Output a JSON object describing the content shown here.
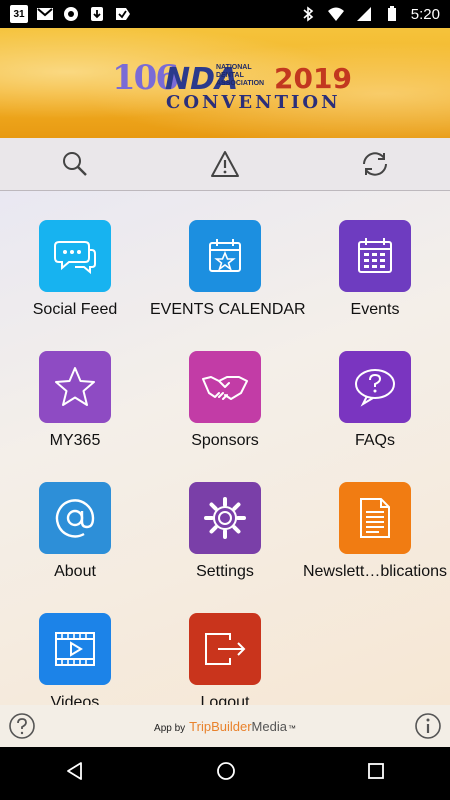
{
  "status_bar": {
    "time": "5:20",
    "calendar_day": "31"
  },
  "banner": {
    "number": "106",
    "org_short": "NDA",
    "org_full": "NATIONAL DENTAL ASSOCIATION",
    "year": "2019",
    "event": "CONVENTION"
  },
  "toolbar": {
    "icons": [
      "search-icon",
      "warning-icon",
      "sync-icon"
    ]
  },
  "tiles": [
    {
      "label": "Social Feed",
      "color": "#17b3f0",
      "icon": "chat-bubbles-icon"
    },
    {
      "label": "EVENTS CALENDAR",
      "color": "#1c8fe0",
      "icon": "calendar-star-icon"
    },
    {
      "label": "Events",
      "color": "#6e3cc0",
      "icon": "calendar-grid-icon"
    },
    {
      "label": "MY365",
      "color": "#8e4bc3",
      "icon": "star-icon"
    },
    {
      "label": "Sponsors",
      "color": "#c23ca6",
      "icon": "handshake-icon"
    },
    {
      "label": "FAQs",
      "color": "#7a35c0",
      "icon": "question-bubble-icon"
    },
    {
      "label": "About",
      "color": "#2d8fd8",
      "icon": "at-sign-icon"
    },
    {
      "label": "Settings",
      "color": "#7a3fa8",
      "icon": "gear-icon"
    },
    {
      "label": "Newslett…blications",
      "color": "#f17c12",
      "icon": "document-icon"
    },
    {
      "label": "Videos",
      "color": "#1c83e8",
      "icon": "film-play-icon"
    },
    {
      "label": "Logout",
      "color": "#c9341c",
      "icon": "logout-icon"
    }
  ],
  "footer": {
    "app_by": "App by",
    "brand_a": "TripBuilder",
    "brand_b": "Media",
    "trademark": "™"
  }
}
